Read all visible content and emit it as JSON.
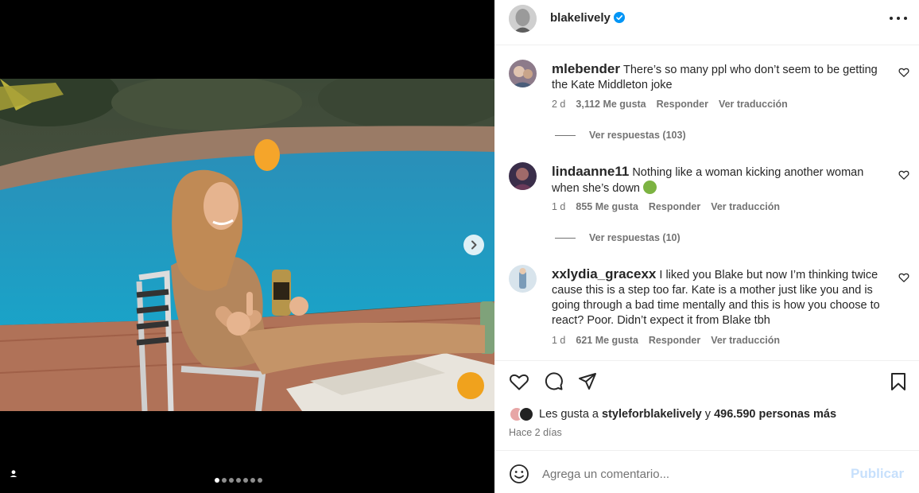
{
  "post": {
    "username": "blakelively",
    "verified": true
  },
  "media": {
    "carousel_count": 7,
    "current_index": 1
  },
  "comments": [
    {
      "username": "mlebender",
      "text": "There’s so many ppl who don’t seem to be getting the Kate Middleton joke",
      "time": "2 d",
      "likes": "3,112 Me gusta",
      "reply": "Responder",
      "translate": "Ver traducción",
      "replies": "Ver respuestas (103)"
    },
    {
      "username": "lindaanne11",
      "text": "Nothing like a woman kicking another woman when she’s down",
      "time": "1 d",
      "likes": "855 Me gusta",
      "reply": "Responder",
      "translate": "Ver traducción",
      "replies": "Ver respuestas (10)"
    },
    {
      "username": "xxlydia_gracexx",
      "text": "I liked you Blake but now I’m thinking twice cause this is a step too far. Kate is a mother just like you and is going through a bad time mentally and this is how you choose to react? Poor. Didn’t expect it from Blake tbh",
      "time": "1 d",
      "likes": "621 Me gusta",
      "reply": "Responder",
      "translate": "Ver traducción"
    }
  ],
  "likes_summary": {
    "prefix": "Les gusta a",
    "user": "styleforblakelively",
    "middle": "y",
    "count": "496.590 personas más"
  },
  "time_ago": "Hace 2 días",
  "add_comment": {
    "placeholder": "Agrega un comentario...",
    "publish": "Publicar"
  },
  "colors": {
    "verified": "#0095f6",
    "muted_text": "#737373",
    "publish_disabled": "#c7e0fc"
  }
}
